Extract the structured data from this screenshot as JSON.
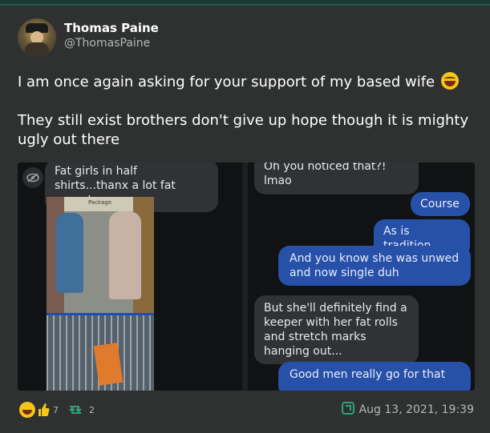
{
  "author": {
    "display_name": "Thomas Paine",
    "handle": "@ThomasPaine"
  },
  "tweet": {
    "line1": "I am once again asking for your support of my based wife",
    "line2": "They still exist brothers don't give up hope though it is mighty ugly out there"
  },
  "screenshot": {
    "left_bubble": "Fat girls in half shirts...thanx a lot fat acceptance",
    "photo_sign": "Package",
    "messages": [
      {
        "text": "Oh you noticed that?!  lmao",
        "side": "gray"
      },
      {
        "text": "Course",
        "side": "blue"
      },
      {
        "text": "As is tradition",
        "side": "blue"
      },
      {
        "text": "And you know she was unwed and now single duh",
        "side": "blue"
      },
      {
        "text": "But she'll definitely find a keeper with her fat rolls and stretch marks hanging out...",
        "side": "gray"
      },
      {
        "text": "Good men really go for that",
        "side": "blue"
      }
    ]
  },
  "footer": {
    "reaction_count": "7",
    "retweet_count": "2",
    "date": "Aug 13, 2021, 19:39"
  },
  "colors": {
    "background": "#2f3131",
    "accent_green": "#2fa37a",
    "bubble_blue": "#2750a8",
    "bubble_gray": "#303235"
  },
  "icons": {
    "reaction_primary": "grinning-squinting-face",
    "reaction_secondary": "thumbs-up",
    "retweet": "retweet-arrows",
    "source": "app-logo"
  }
}
